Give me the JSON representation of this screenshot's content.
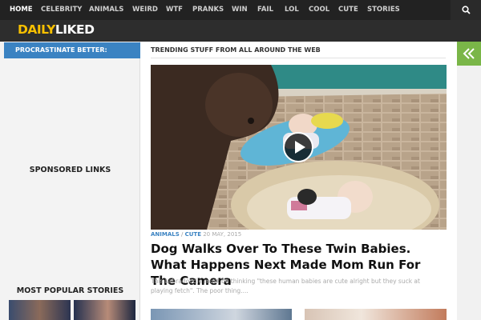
{
  "nav": {
    "items": [
      {
        "label": "HOME",
        "active": true
      },
      {
        "label": "CELEBRITY",
        "active": false
      },
      {
        "label": "ANIMALS",
        "active": false
      },
      {
        "label": "WEIRD",
        "active": false
      },
      {
        "label": "WTF",
        "active": false
      },
      {
        "label": "PRANKS",
        "active": false
      },
      {
        "label": "WIN",
        "active": false
      },
      {
        "label": "FAIL",
        "active": false
      },
      {
        "label": "LOL",
        "active": false
      },
      {
        "label": "COOL",
        "active": false
      },
      {
        "label": "CUTE",
        "active": false
      },
      {
        "label": "STORIES",
        "active": false
      }
    ],
    "search_icon": "search-icon"
  },
  "logo": {
    "part1": "DAILY",
    "part2": "LIKED"
  },
  "sidebar": {
    "title": "PROCRASTINATE BETTER:",
    "sponsored": "SPONSORED LINKS",
    "most_popular": "MOST POPULAR STORIES"
  },
  "main": {
    "section_title": "TRENDING STUFF FROM ALL AROUND THE WEB",
    "article": {
      "category1": "ANIMALS",
      "separator": "/",
      "category2": "CUTE",
      "date": "20 MAY, 2015",
      "headline": "Dog Walks Over To These Twin Babies. What Happens Next Made Mom Run For The Camera",
      "excerpt": "This Labradoodle must be thinking \"these human babies are cute alright but they suck at playing fetch\". The poor thing...."
    }
  },
  "colors": {
    "accent_blue": "#3b83c2",
    "accent_green": "#7ab648",
    "logo_yellow": "#f7c000",
    "nav_bg": "#222222"
  },
  "icons": {
    "toggle": "double-chevron-left-icon",
    "play": "play-icon"
  }
}
